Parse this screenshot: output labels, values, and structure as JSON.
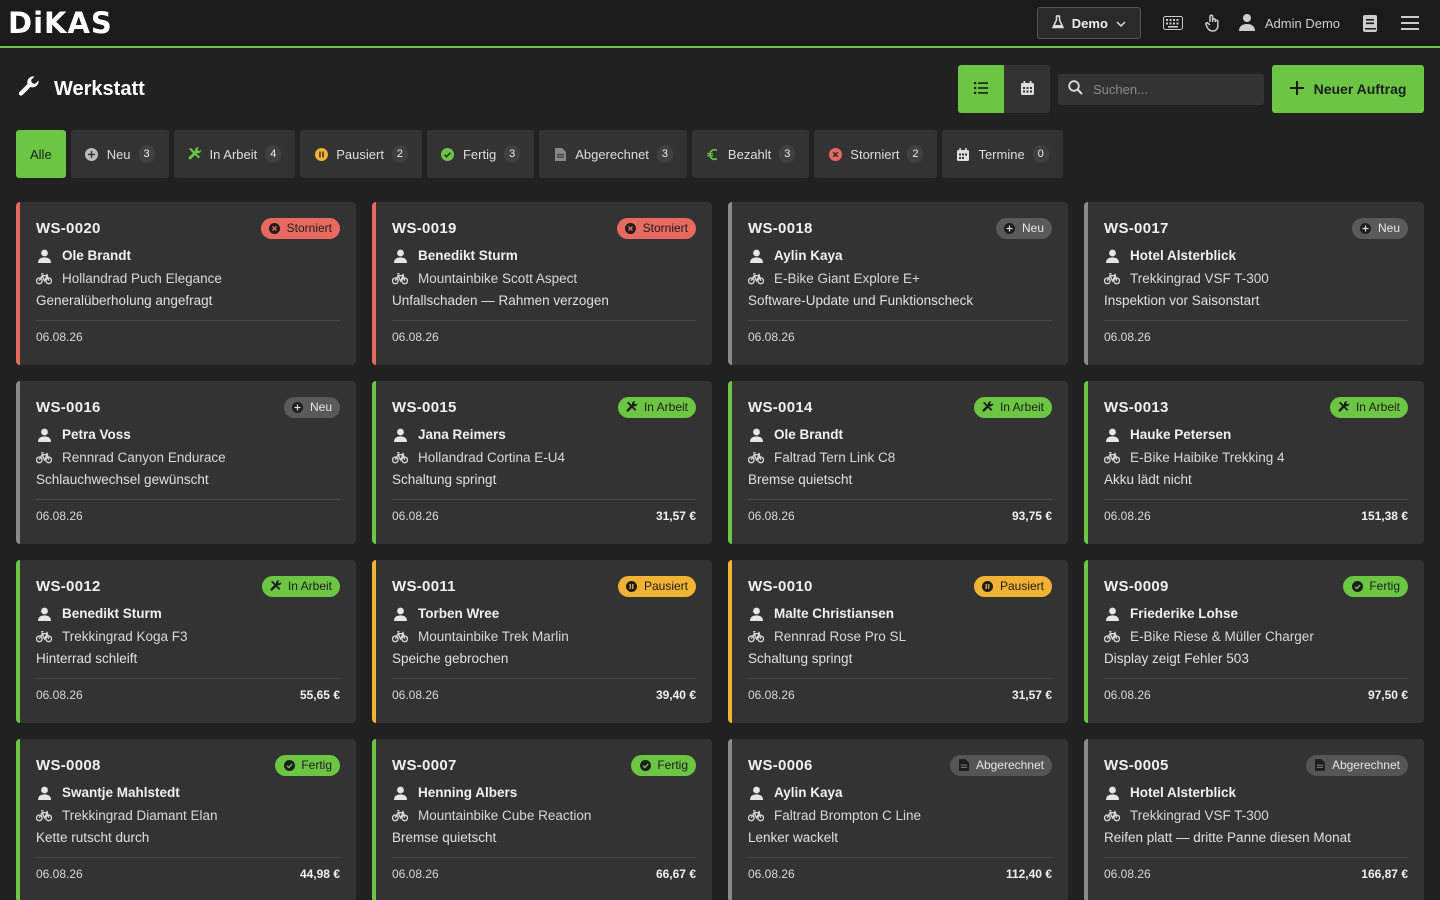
{
  "app": {
    "logo": "DiKAS"
  },
  "topbar": {
    "demo_label": "Demo",
    "user_name": "Admin Demo"
  },
  "page": {
    "title": "Werkstatt"
  },
  "search": {
    "placeholder": "Suchen..."
  },
  "new_button": {
    "label": "Neuer Auftrag"
  },
  "filters": [
    {
      "label": "Alle",
      "count": null,
      "icon": "none"
    },
    {
      "label": "Neu",
      "count": "3",
      "icon": "plus-circle-icon"
    },
    {
      "label": "In Arbeit",
      "count": "4",
      "icon": "tools-icon"
    },
    {
      "label": "Pausiert",
      "count": "2",
      "icon": "pause-circle-icon"
    },
    {
      "label": "Fertig",
      "count": "3",
      "icon": "check-circle-icon"
    },
    {
      "label": "Abgerechnet",
      "count": "3",
      "icon": "document-icon"
    },
    {
      "label": "Bezahlt",
      "count": "3",
      "icon": "euro-icon"
    },
    {
      "label": "Storniert",
      "count": "2",
      "icon": "x-circle-icon"
    },
    {
      "label": "Termine",
      "count": "0",
      "icon": "calendar-icon"
    }
  ],
  "colors": {
    "accent": "#6cc644",
    "storniert": "#e8695f",
    "pausiert": "#f2b233",
    "neutral": "#5a5a5a"
  },
  "orders": [
    {
      "id": "WS-0020",
      "status": "Storniert",
      "status_key": "storniert",
      "customer": "Ole Brandt",
      "bike": "Hollandrad Puch Elegance",
      "description": "Generalüberholung angefragt",
      "date": "06.08.26",
      "price": ""
    },
    {
      "id": "WS-0019",
      "status": "Storniert",
      "status_key": "storniert",
      "customer": "Benedikt Sturm",
      "bike": "Mountainbike Scott Aspect",
      "description": "Unfallschaden — Rahmen verzogen",
      "date": "06.08.26",
      "price": ""
    },
    {
      "id": "WS-0018",
      "status": "Neu",
      "status_key": "neu",
      "customer": "Aylin Kaya",
      "bike": "E-Bike Giant Explore E+",
      "description": "Software-Update und Funktionscheck",
      "date": "06.08.26",
      "price": ""
    },
    {
      "id": "WS-0017",
      "status": "Neu",
      "status_key": "neu",
      "customer": "Hotel Alsterblick",
      "bike": "Trekkingrad VSF T-300",
      "description": "Inspektion vor Saisonstart",
      "date": "06.08.26",
      "price": ""
    },
    {
      "id": "WS-0016",
      "status": "Neu",
      "status_key": "neu",
      "customer": "Petra Voss",
      "bike": "Rennrad Canyon Endurace",
      "description": "Schlauchwechsel gewünscht",
      "date": "06.08.26",
      "price": ""
    },
    {
      "id": "WS-0015",
      "status": "In Arbeit",
      "status_key": "inarbeit",
      "customer": "Jana Reimers",
      "bike": "Hollandrad Cortina E-U4",
      "description": "Schaltung springt",
      "date": "06.08.26",
      "price": "31,57 €"
    },
    {
      "id": "WS-0014",
      "status": "In Arbeit",
      "status_key": "inarbeit",
      "customer": "Ole Brandt",
      "bike": "Faltrad Tern Link C8",
      "description": "Bremse quietscht",
      "date": "06.08.26",
      "price": "93,75 €"
    },
    {
      "id": "WS-0013",
      "status": "In Arbeit",
      "status_key": "inarbeit",
      "customer": "Hauke Petersen",
      "bike": "E-Bike Haibike Trekking 4",
      "description": "Akku lädt nicht",
      "date": "06.08.26",
      "price": "151,38 €"
    },
    {
      "id": "WS-0012",
      "status": "In Arbeit",
      "status_key": "inarbeit",
      "customer": "Benedikt Sturm",
      "bike": "Trekkingrad Koga F3",
      "description": "Hinterrad schleift",
      "date": "06.08.26",
      "price": "55,65 €"
    },
    {
      "id": "WS-0011",
      "status": "Pausiert",
      "status_key": "pausiert",
      "customer": "Torben Wree",
      "bike": "Mountainbike Trek Marlin",
      "description": "Speiche gebrochen",
      "date": "06.08.26",
      "price": "39,40 €"
    },
    {
      "id": "WS-0010",
      "status": "Pausiert",
      "status_key": "pausiert",
      "customer": "Malte Christiansen",
      "bike": "Rennrad Rose Pro SL",
      "description": "Schaltung springt",
      "date": "06.08.26",
      "price": "31,57 €"
    },
    {
      "id": "WS-0009",
      "status": "Fertig",
      "status_key": "fertig",
      "customer": "Friederike Lohse",
      "bike": "E-Bike Riese & Müller Charger",
      "description": "Display zeigt Fehler 503",
      "date": "06.08.26",
      "price": "97,50 €"
    },
    {
      "id": "WS-0008",
      "status": "Fertig",
      "status_key": "fertig",
      "customer": "Swantje Mahlstedt",
      "bike": "Trekkingrad Diamant Elan",
      "description": "Kette rutscht durch",
      "date": "06.08.26",
      "price": "44,98 €"
    },
    {
      "id": "WS-0007",
      "status": "Fertig",
      "status_key": "fertig",
      "customer": "Henning Albers",
      "bike": "Mountainbike Cube Reaction",
      "description": "Bremse quietscht",
      "date": "06.08.26",
      "price": "66,67 €"
    },
    {
      "id": "WS-0006",
      "status": "Abgerechnet",
      "status_key": "abgerechnet",
      "customer": "Aylin Kaya",
      "bike": "Faltrad Brompton C Line",
      "description": "Lenker wackelt",
      "date": "06.08.26",
      "price": "112,40 €"
    },
    {
      "id": "WS-0005",
      "status": "Abgerechnet",
      "status_key": "abgerechnet",
      "customer": "Hotel Alsterblick",
      "bike": "Trekkingrad VSF T-300",
      "description": "Reifen platt — dritte Panne diesen Monat",
      "date": "06.08.26",
      "price": "166,87 €"
    }
  ]
}
